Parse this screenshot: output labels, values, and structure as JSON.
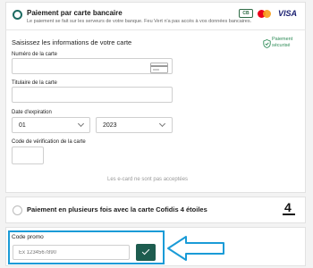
{
  "payment_card": {
    "title": "Paiement par carte bancaire",
    "subtitle": "Le paiement se fait sur les serveurs de votre banque. Feu Vert n'a pas accès à vos données bancaires.",
    "logos": {
      "cb": "CB",
      "visa": "VISA"
    },
    "section_title": "Saisissez les informations de votre carte",
    "secure_label": "Paiement sécurisé",
    "card_number_label": "Numéro de la carte",
    "card_number_value": "",
    "holder_label": "Titulaire de la carte",
    "holder_value": "",
    "expiry_label": "Date d'expiration",
    "expiry_month": "01",
    "expiry_year": "2023",
    "cvv_label": "Code de vérification de la carte",
    "cvv_value": "",
    "ecard_notice": "Les e-card ne sont pas acceptées"
  },
  "installments": {
    "title": "Paiement en plusieurs fois avec la carte Cofidis 4 étoiles",
    "logo_text": "4"
  },
  "promo": {
    "label": "Code promo",
    "placeholder": "Ex 1234567890",
    "value": ""
  },
  "colors": {
    "accent": "#1d5c4f",
    "highlight": "#1a9bd7",
    "secure_green": "#2e8b57"
  }
}
